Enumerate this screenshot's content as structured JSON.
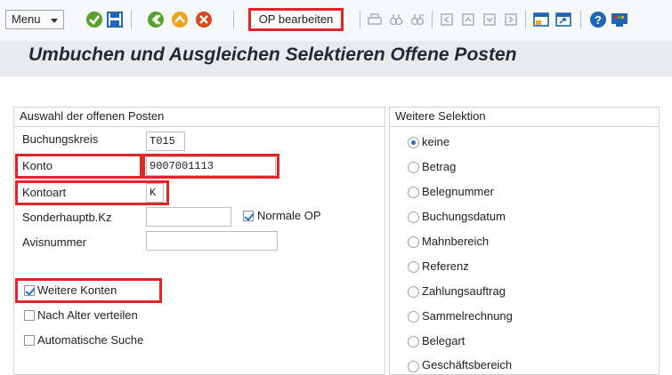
{
  "toolbar": {
    "menu_label": "Menu",
    "op_button_label": "OP bearbeiten",
    "icons": [
      "check-icon",
      "save-icon",
      "back-icon",
      "exit-icon",
      "cancel-icon",
      "print-icon",
      "find-icon",
      "find-next-icon",
      "first-page-icon",
      "prev-page-icon",
      "next-page-icon",
      "last-page-icon",
      "new-session-icon",
      "shortcut-icon",
      "help-icon",
      "layout-icon"
    ]
  },
  "title": "Umbuchen und Ausgleichen Selektieren Offene Posten",
  "left_panel": {
    "header": "Auswahl der offenen Posten",
    "fields": {
      "buchungskreis": {
        "label": "Buchungskreis",
        "value": "T015"
      },
      "konto": {
        "label": "Konto",
        "value": "9007001113"
      },
      "kontoart": {
        "label": "Kontoart",
        "value": "K"
      },
      "sonderhauptb": {
        "label": "Sonderhauptb.Kz",
        "value": ""
      },
      "avisnummer": {
        "label": "Avisnummer",
        "value": ""
      }
    },
    "normale_op": {
      "label": "Normale OP",
      "checked": true
    },
    "checkboxes": [
      {
        "label": "Weitere Konten",
        "checked": true
      },
      {
        "label": "Nach Alter verteilen",
        "checked": false
      },
      {
        "label": "Automatische Suche",
        "checked": false
      }
    ]
  },
  "right_panel": {
    "header": "Weitere Selektion",
    "options": [
      "keine",
      "Betrag",
      "Belegnummer",
      "Buchungsdatum",
      "Mahnbereich",
      "Referenz",
      "Zahlungsauftrag",
      "Sammelrechnung",
      "Belegart",
      "Geschäftsbereich"
    ],
    "selected": "keine"
  },
  "colors": {
    "highlight": "#e32625",
    "accent": "#2a6fd0"
  }
}
